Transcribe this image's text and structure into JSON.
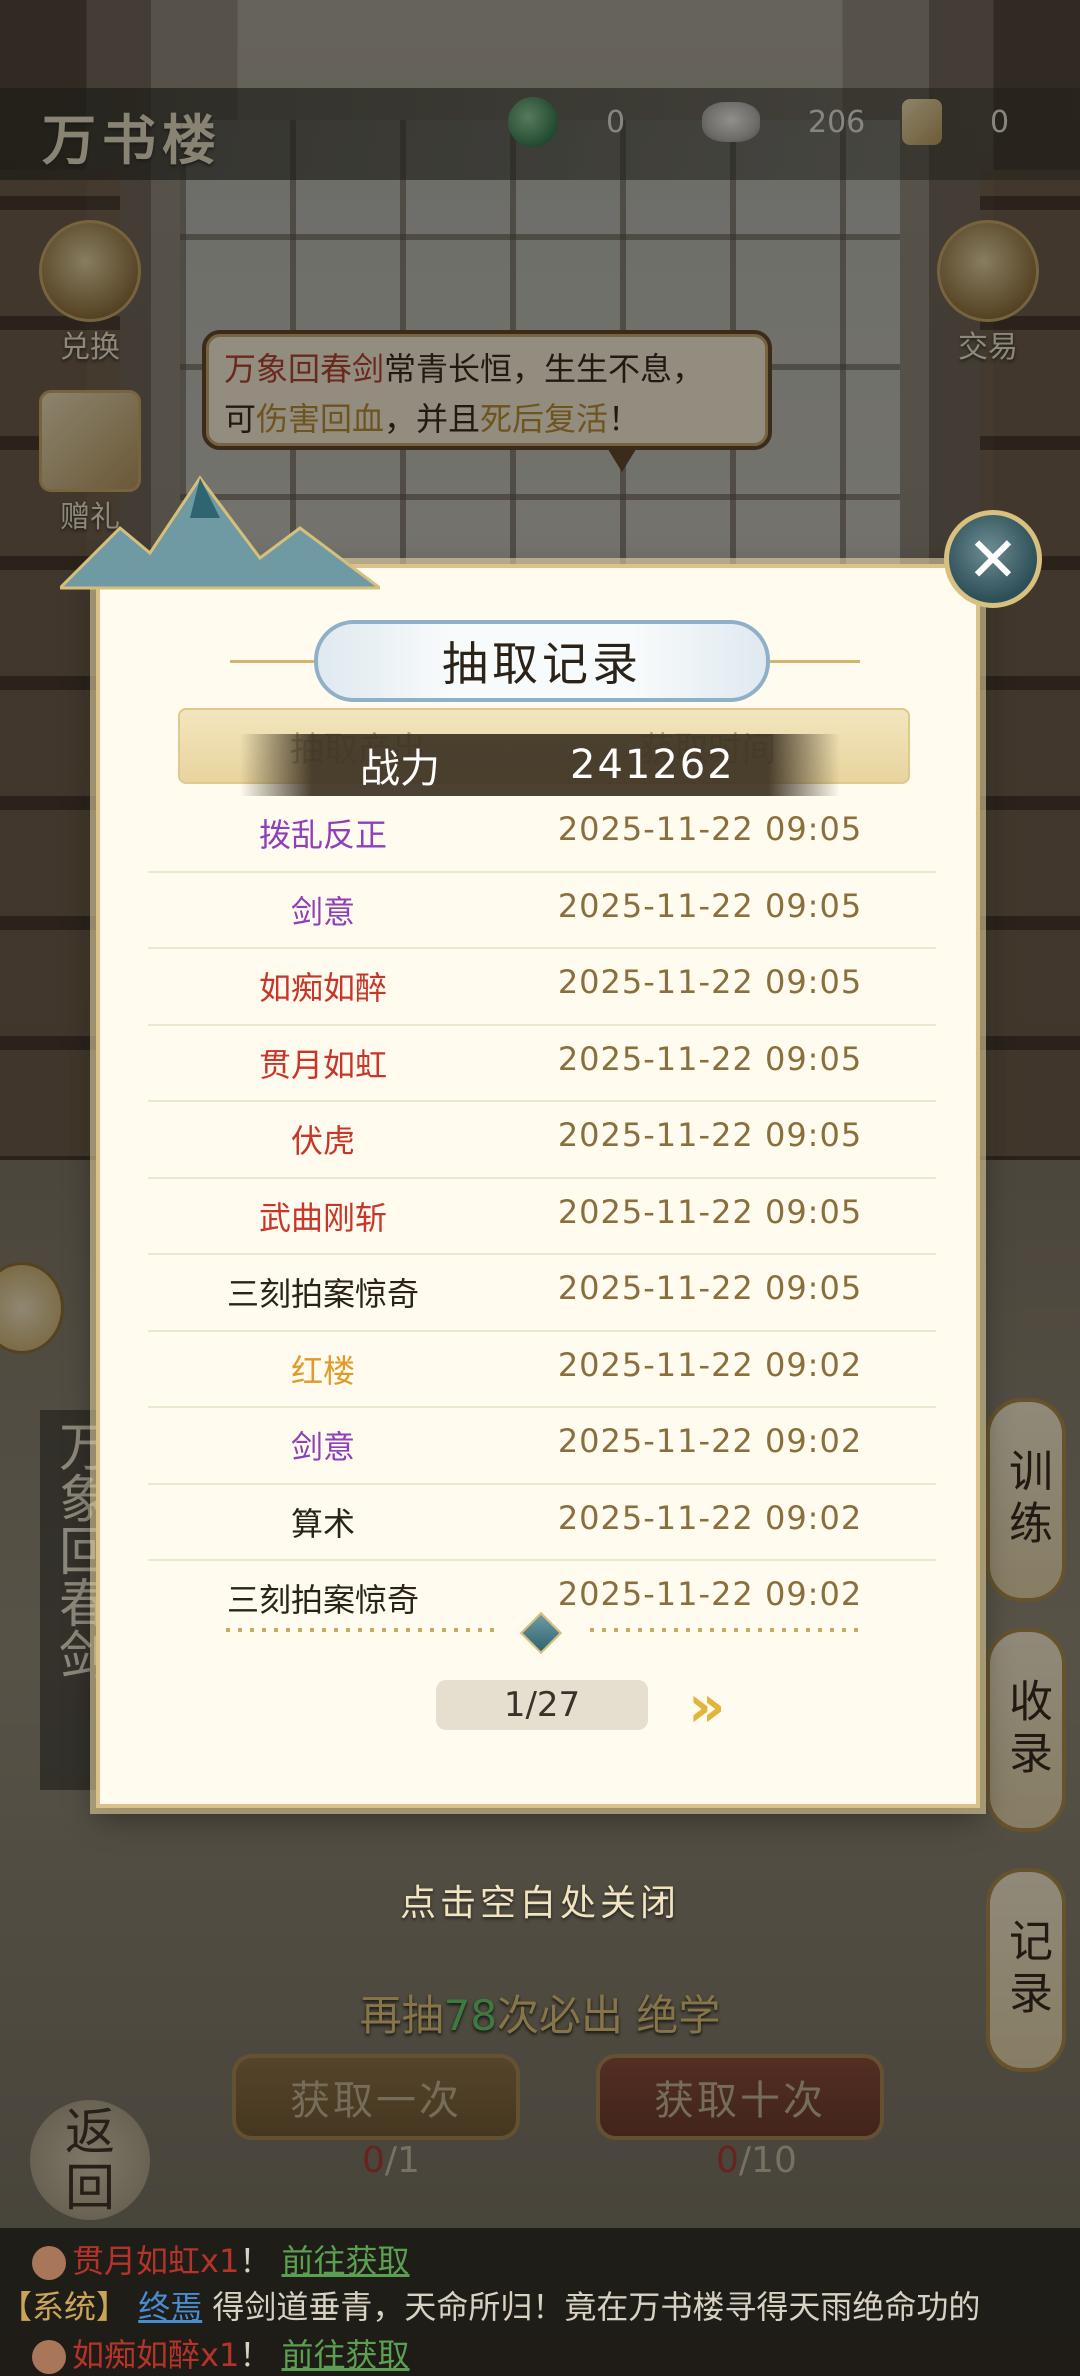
{
  "header": {
    "title": "万书楼",
    "resources": [
      {
        "icon": "jade-coin-icon",
        "value": "0"
      },
      {
        "icon": "silver-ingot-icon",
        "value": "206"
      },
      {
        "icon": "scroll-ticket-icon",
        "value": "0"
      }
    ]
  },
  "side_buttons": {
    "exchange": "兑换",
    "gift": "赠礼",
    "trade": "交易"
  },
  "bubble": {
    "part1": "万象回春剑",
    "part2": "常青长恒，生生不息，",
    "part3": "可",
    "part4": "伤害回血",
    "part5": "，并且",
    "part6": "死后复活",
    "part7": "！"
  },
  "right_buttons": [
    "训练",
    "收录",
    "记录"
  ],
  "vertical_title": "万象回春剑",
  "modal": {
    "title": "抽取记录",
    "columns": [
      "抽取产出",
      "获取时间"
    ],
    "power_label": "战力",
    "power_value": "241262",
    "records": [
      {
        "name": "拨乱反正",
        "time": "2025-11-22  09:05",
        "color": "purple"
      },
      {
        "name": "剑意",
        "time": "2025-11-22  09:05",
        "color": "purple"
      },
      {
        "name": "如痴如醉",
        "time": "2025-11-22  09:05",
        "color": "red"
      },
      {
        "name": "贯月如虹",
        "time": "2025-11-22  09:05",
        "color": "red"
      },
      {
        "name": "伏虎",
        "time": "2025-11-22  09:05",
        "color": "red"
      },
      {
        "name": "武曲刚斩",
        "time": "2025-11-22  09:05",
        "color": "red"
      },
      {
        "name": "三刻拍案惊奇",
        "time": "2025-11-22  09:05",
        "color": "black"
      },
      {
        "name": "红楼",
        "time": "2025-11-22  09:02",
        "color": "orange"
      },
      {
        "name": "剑意",
        "time": "2025-11-22  09:02",
        "color": "purple"
      },
      {
        "name": "算术",
        "time": "2025-11-22  09:02",
        "color": "black"
      },
      {
        "name": "三刻拍案惊奇",
        "time": "2025-11-22  09:02",
        "color": "black"
      }
    ],
    "page": "1/27",
    "next": "»"
  },
  "bottom": {
    "hint": "点击空白处关闭",
    "guarantee_pre": "再抽",
    "guarantee_num": "78",
    "guarantee_post": "次必出 绝学",
    "draw_once": "获取一次",
    "draw_ten": "获取十次",
    "cost_once_have": "0",
    "cost_once_need": "/1",
    "cost_ten_have": "0",
    "cost_ten_need": "/10",
    "back": [
      "返",
      "回"
    ]
  },
  "ticker": [
    {
      "item": "贯月如虹x1",
      "sep": "！  ",
      "link": "前往获取"
    },
    {
      "sys": "【系统】",
      "who": "终焉",
      "text": " 得剑道垂青，天命所归！竟在万书楼寻得天雨绝命功的"
    },
    {
      "item": "如痴如醉x1",
      "sep": "！  ",
      "link": "前往获取"
    }
  ],
  "colors": {
    "purple": "#8f3fb8",
    "red": "#c8362a",
    "orange": "#e09a2a",
    "black": "#2b2218"
  }
}
